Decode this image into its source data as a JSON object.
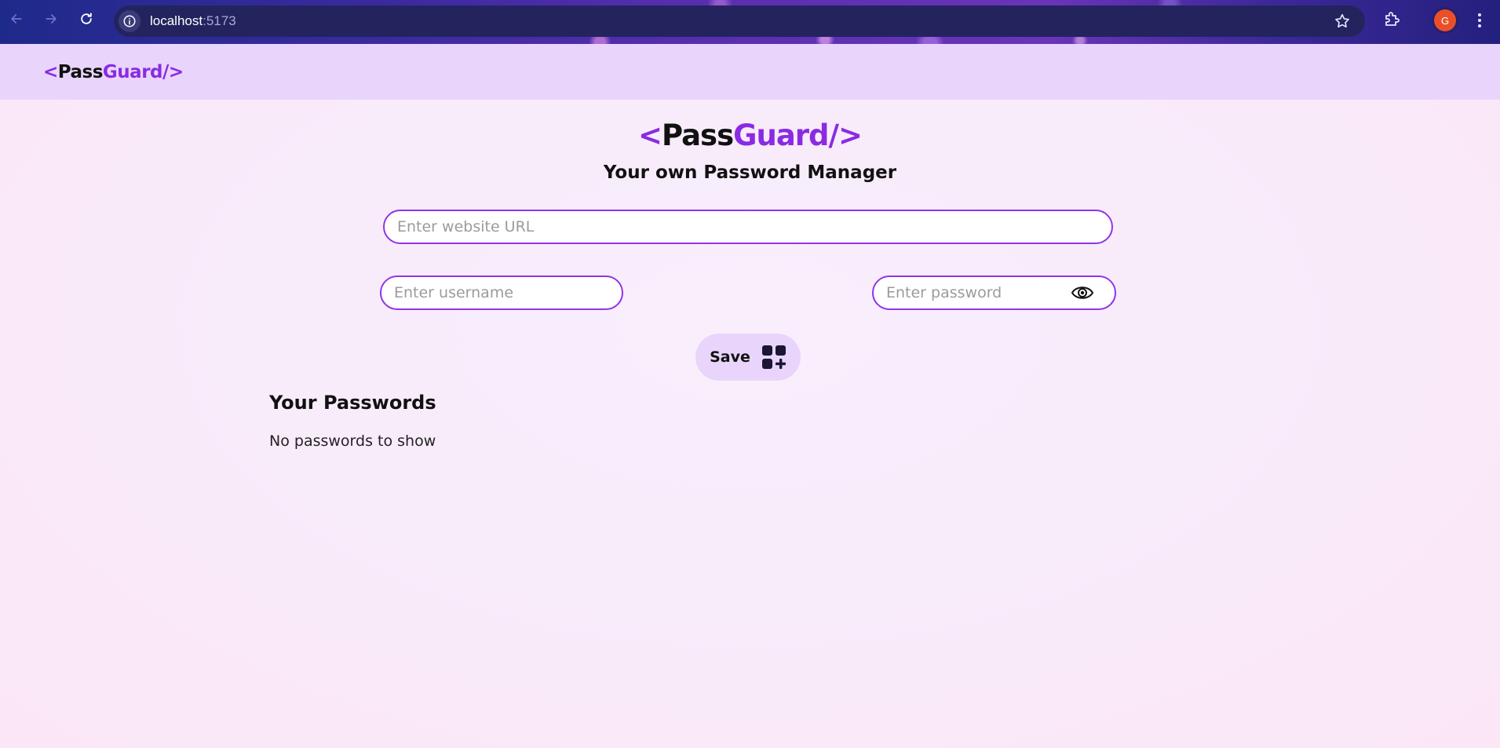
{
  "browser": {
    "url_host": "localhost",
    "url_port": ":5173",
    "profile_initial": "G"
  },
  "navbar": {
    "logo": {
      "open": "<",
      "pass": "Pass",
      "guard": "Guard",
      "close": "/>"
    }
  },
  "hero": {
    "logo": {
      "open": "<",
      "pass": "Pass",
      "guard": "Guard",
      "close": "/>"
    },
    "tagline": "Your own Password Manager"
  },
  "form": {
    "url_placeholder": "Enter website URL",
    "username_placeholder": "Enter username",
    "password_placeholder": "Enter password",
    "save_label": "Save"
  },
  "passwords": {
    "title": "Your Passwords",
    "empty_message": "No passwords to show"
  },
  "colors": {
    "accent": "#8a2be2",
    "navbar_bg": "#e9d5fc",
    "button_bg": "#e9d5fc"
  }
}
